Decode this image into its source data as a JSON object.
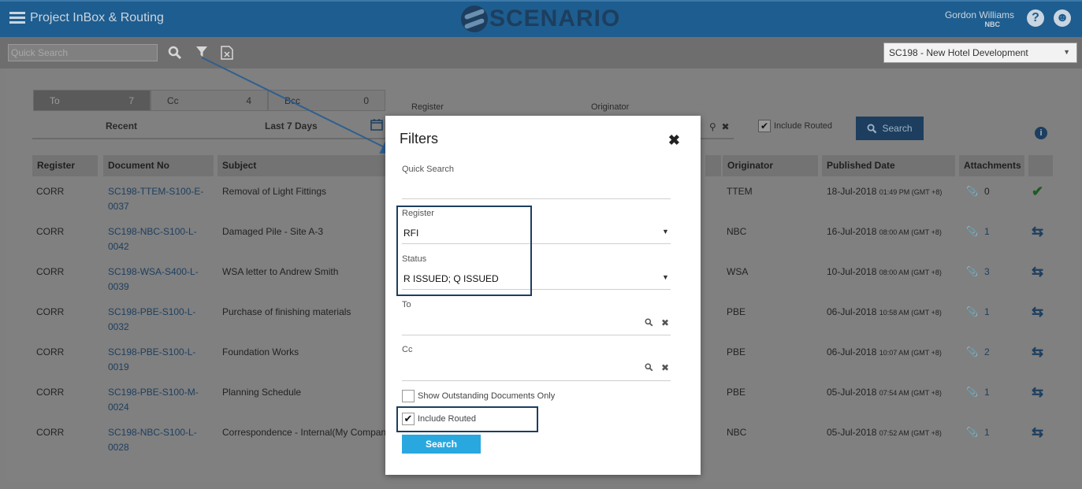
{
  "header": {
    "app_title": "Project InBox & Routing",
    "logo_text": "SCENARIO",
    "user_name": "Gordon Williams",
    "user_org": "NBC",
    "help_icon": "question-circle-icon",
    "user_icon": "user-circle-icon"
  },
  "toolbar": {
    "quick_search_placeholder": "Quick Search",
    "project": "SC198 - New Hotel Development"
  },
  "tabs": [
    {
      "label": "To",
      "count": "7"
    },
    {
      "label": "Cc",
      "count": "4"
    },
    {
      "label": "Bcc",
      "count": "0"
    }
  ],
  "period": {
    "recent": "Recent",
    "last7": "Last 7 Days"
  },
  "filter_bar": {
    "register_label": "Register",
    "originator_label": "Originator",
    "include_routed": "Include Routed",
    "search": "Search"
  },
  "columns": {
    "register": "Register",
    "document_no": "Document No",
    "subject": "Subject",
    "originator": "Originator",
    "published_date": "Published Date",
    "attachments": "Attachments"
  },
  "rows": [
    {
      "register": "CORR",
      "doc1": "SC198-TTEM-S100-E-",
      "doc2": "0037",
      "subject": "Removal of Light Fittings",
      "originator": "TTEM",
      "date": "18-Jul-2018",
      "time": "01:49 PM (GMT +8)",
      "attachments": "0",
      "status": "check"
    },
    {
      "register": "CORR",
      "doc1": "SC198-NBC-S100-L-",
      "doc2": "0042",
      "subject": "Damaged Pile - Site A-3",
      "originator": "NBC",
      "date": "16-Jul-2018",
      "time": "08:00 AM (GMT +8)",
      "attachments": "1",
      "status": "route"
    },
    {
      "register": "CORR",
      "doc1": "SC198-WSA-S400-L-",
      "doc2": "0039",
      "subject": "WSA letter to Andrew Smith",
      "originator": "WSA",
      "date": "10-Jul-2018",
      "time": "08:00 AM (GMT +8)",
      "attachments": "3",
      "status": "route"
    },
    {
      "register": "CORR",
      "doc1": "SC198-PBE-S100-L-",
      "doc2": "0032",
      "subject": "Purchase of finishing materials",
      "originator": "PBE",
      "date": "06-Jul-2018",
      "time": "10:58 AM (GMT +8)",
      "attachments": "1",
      "status": "route"
    },
    {
      "register": "CORR",
      "doc1": "SC198-PBE-S100-L-",
      "doc2": "0019",
      "subject": "Foundation Works",
      "originator": "PBE",
      "date": "06-Jul-2018",
      "time": "10:07 AM (GMT +8)",
      "attachments": "2",
      "status": "route"
    },
    {
      "register": "CORR",
      "doc1": "SC198-PBE-S100-M-",
      "doc2": "0024",
      "subject": "Planning Schedule",
      "originator": "PBE",
      "date": "05-Jul-2018",
      "time": "07:54 AM (GMT +8)",
      "attachments": "1",
      "status": "route"
    },
    {
      "register": "CORR",
      "doc1": "SC198-NBC-S100-L-",
      "doc2": "0028",
      "subject": "Correspondence - Internal(My Company",
      "originator": "NBC",
      "date": "05-Jul-2018",
      "time": "07:52 AM (GMT +8)",
      "attachments": "1",
      "status": "route"
    }
  ],
  "modal": {
    "title": "Filters",
    "quick_search_label": "Quick Search",
    "register_label": "Register",
    "register_value": "RFI",
    "status_label": "Status",
    "status_value": "R ISSUED; Q ISSUED",
    "to_label": "To",
    "cc_label": "Cc",
    "show_outstanding": "Show Outstanding Documents Only",
    "include_routed": "Include Routed",
    "search": "Search"
  },
  "colors": {
    "header": "#1e5d8f",
    "accent": "#29a8e0",
    "highlight_border": "#1d3e5e"
  }
}
